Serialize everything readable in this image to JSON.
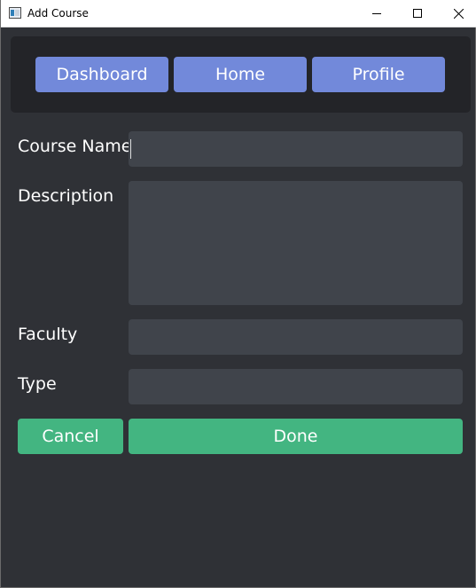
{
  "window": {
    "title": "Add Course",
    "controls": {
      "minimize_icon": "minimize-icon",
      "maximize_icon": "maximize-icon",
      "close_icon": "close-icon"
    }
  },
  "nav": {
    "dashboard": "Dashboard",
    "home": "Home",
    "profile": "Profile"
  },
  "form": {
    "course_name": {
      "label": "Course Name",
      "value": ""
    },
    "description": {
      "label": "Description",
      "value": ""
    },
    "faculty": {
      "label": "Faculty",
      "value": ""
    },
    "type": {
      "label": "Type",
      "value": ""
    }
  },
  "actions": {
    "cancel": "Cancel",
    "done": "Done"
  },
  "colors": {
    "background": "#2f3136",
    "navbar": "#232428",
    "nav_button": "#7289da",
    "input": "#40444b",
    "action_button": "#43b581",
    "text": "#ffffff"
  }
}
